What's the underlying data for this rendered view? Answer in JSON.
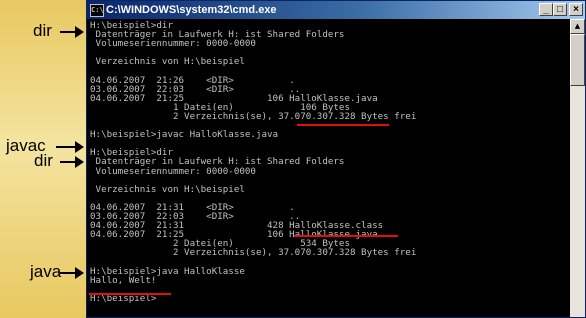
{
  "window": {
    "title": "C:\\WINDOWS\\system32\\cmd.exe",
    "icon_glyph": "C:\\",
    "buttons": {
      "minimize": "_",
      "maximize": "□",
      "close": "×"
    }
  },
  "annotations": {
    "dir1": "dir",
    "javac": "javac",
    "dir2": "dir",
    "java": "java"
  },
  "console": {
    "lines": [
      "H:\\beispiel>dir",
      " Datenträger in Laufwerk H: ist Shared Folders",
      " Volumeseriennummer: 0000-0000",
      "",
      " Verzeichnis von H:\\beispiel",
      "",
      "04.06.2007  21:26    <DIR>          .",
      "03.06.2007  22:03    <DIR>          ..",
      "04.06.2007  21:25               106 HalloKlasse.java",
      "               1 Datei(en)            106 Bytes",
      "               2 Verzeichnis(se), 37.070.307.328 Bytes frei",
      "",
      "H:\\beispiel>javac HalloKlasse.java",
      "",
      "H:\\beispiel>dir",
      " Datenträger in Laufwerk H: ist Shared Folders",
      " Volumeseriennummer: 0000-0000",
      "",
      " Verzeichnis von H:\\beispiel",
      "",
      "04.06.2007  21:31    <DIR>          .",
      "03.06.2007  22:03    <DIR>          ..",
      "04.06.2007  21:31               428 HalloKlasse.class",
      "04.06.2007  21:25               106 HalloKlasse.java",
      "               2 Datei(en)            534 Bytes",
      "               2 Verzeichnis(se), 37.070.307.328 Bytes frei",
      "",
      "H:\\beispiel>java HalloKlasse",
      "Hallo, Welt!",
      "",
      "H:\\beispiel>"
    ]
  },
  "colors": {
    "console_text": "#c0c0c0",
    "console_bg": "#000000",
    "underline": "#e01010",
    "title_bar": "#0a246a"
  }
}
